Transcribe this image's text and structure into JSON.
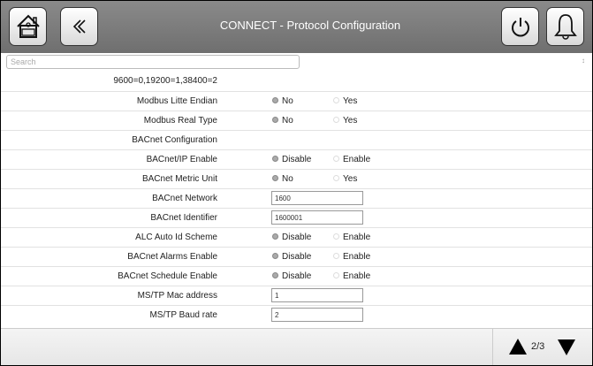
{
  "header": {
    "title": "CONNECT - Protocol Configuration"
  },
  "search": {
    "placeholder": "Search",
    "sort_icon": "↕"
  },
  "baud_note": "9600=0,19200=1,38400=2",
  "rows": [
    {
      "label": "Modbus Litte Endian",
      "type": "radio",
      "opt1": "No",
      "opt2": "Yes",
      "selected": 1
    },
    {
      "label": "Modbus Real Type",
      "type": "radio",
      "opt1": "No",
      "opt2": "Yes",
      "selected": 1
    },
    {
      "label": "BACnet Configuration",
      "type": "section"
    },
    {
      "label": "BACnet/IP Enable",
      "type": "radio",
      "opt1": "Disable",
      "opt2": "Enable",
      "selected": 1
    },
    {
      "label": "BACnet Metric Unit",
      "type": "radio",
      "opt1": "No",
      "opt2": "Yes",
      "selected": 1
    },
    {
      "label": "BACnet Network",
      "type": "input",
      "value": "1600"
    },
    {
      "label": "BACnet Identifier",
      "type": "input",
      "value": "1600001"
    },
    {
      "label": "ALC Auto Id Scheme",
      "type": "radio",
      "opt1": "Disable",
      "opt2": "Enable",
      "selected": 1
    },
    {
      "label": "BACnet Alarms Enable",
      "type": "radio",
      "opt1": "Disable",
      "opt2": "Enable",
      "selected": 1
    },
    {
      "label": "BACnet Schedule Enable",
      "type": "radio",
      "opt1": "Disable",
      "opt2": "Enable",
      "selected": 1
    },
    {
      "label": "MS/TP Mac address",
      "type": "input",
      "value": "1"
    },
    {
      "label": "MS/TP Baud rate",
      "type": "input",
      "value": "2"
    }
  ],
  "pager": {
    "text": "2/3"
  }
}
